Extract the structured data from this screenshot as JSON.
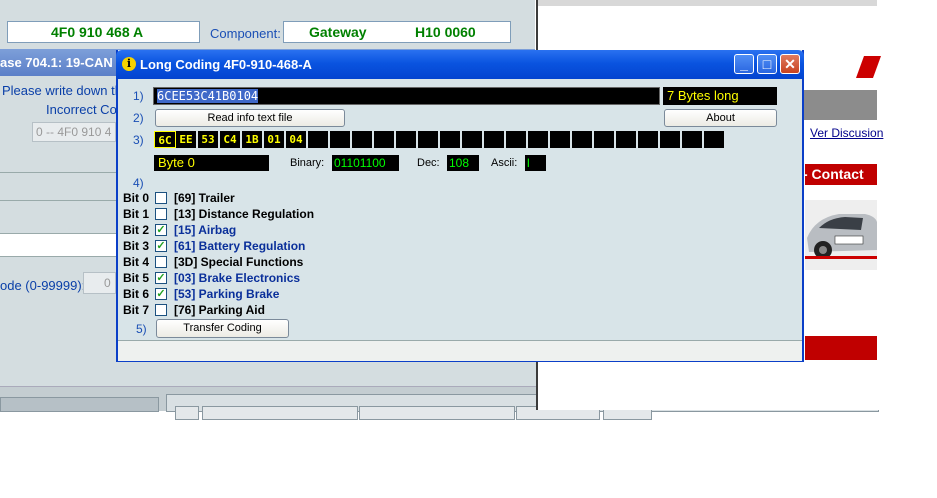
{
  "background_left": {
    "part_number": "4F0 910 468 A",
    "component_label": "Component:",
    "component_value": "Gateway",
    "component_version": "H10 0060",
    "window_caption": "ase 704.1: 19-CAN",
    "prompt_line": "Please write down th",
    "incorrect_line": "Incorrect Co",
    "grey_field": "0 -- 4F0 910 4",
    "code_label": "ode (0-99999):",
    "code_value": "0"
  },
  "background_right": {
    "link_text": "Ver Discusion",
    "red_bar_text": "- Contact"
  },
  "dialog": {
    "title": "Long Coding 4F0-910-468-A",
    "title_icon": "info-icon",
    "minimize_glyph": "_",
    "maximize_glyph": "□",
    "close_glyph": "✕",
    "steps": [
      "1)",
      "2)",
      "3)",
      "4)",
      "5)"
    ],
    "coding_value": "6CEE53C41B0104",
    "bytes_long": "7 Bytes long",
    "read_info_button": "Read info text file",
    "about_button": "About",
    "bytes": [
      "6C",
      "EE",
      "53",
      "C4",
      "1B",
      "01",
      "04"
    ],
    "byte_label": "Byte 0",
    "binary_label": "Binary:",
    "binary_value": "01101100",
    "dec_label": "Dec:",
    "dec_value": "108",
    "ascii_label": "Ascii:",
    "ascii_value": "l",
    "bits": [
      {
        "bit": "Bit 0",
        "text": "[69] Trailer",
        "checked": false
      },
      {
        "bit": "Bit 1",
        "text": "[13] Distance Regulation",
        "checked": false
      },
      {
        "bit": "Bit 2",
        "text": "[15] Airbag",
        "checked": true
      },
      {
        "bit": "Bit 3",
        "text": "[61] Battery Regulation",
        "checked": true
      },
      {
        "bit": "Bit 4",
        "text": "[3D] Special Functions",
        "checked": false
      },
      {
        "bit": "Bit 5",
        "text": "[03] Brake Electronics",
        "checked": true
      },
      {
        "bit": "Bit 6",
        "text": "[53] Parking Brake",
        "checked": true
      },
      {
        "bit": "Bit 7",
        "text": "[76] Parking Aid",
        "checked": false
      }
    ],
    "check_glyph": "✓",
    "transfer_button": "Transfer Coding"
  },
  "colors": {
    "titlebar": "#0a54e0",
    "dialog_bg": "#d8e4e8",
    "field_text_yellow": "#ffff00",
    "field_text_green": "#00ff00",
    "checked_text": "#0a2f9a"
  }
}
